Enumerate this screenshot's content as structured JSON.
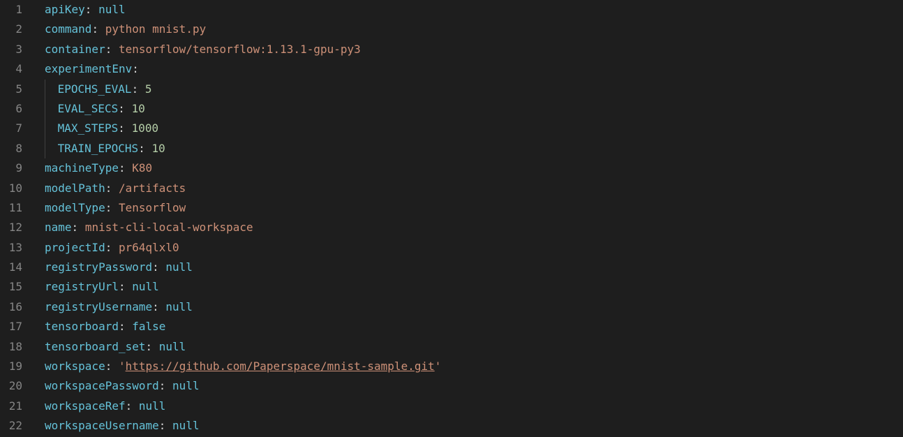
{
  "lines": [
    {
      "num": "1",
      "indent": 0,
      "guide": false,
      "key": "apiKey",
      "valueType": "null",
      "value": "null"
    },
    {
      "num": "2",
      "indent": 0,
      "guide": false,
      "key": "command",
      "valueType": "str",
      "value": "python mnist.py"
    },
    {
      "num": "3",
      "indent": 0,
      "guide": false,
      "key": "container",
      "valueType": "str",
      "value": "tensorflow/tensorflow:1.13.1-gpu-py3"
    },
    {
      "num": "4",
      "indent": 0,
      "guide": false,
      "key": "experimentEnv",
      "valueType": "none",
      "value": ""
    },
    {
      "num": "5",
      "indent": 1,
      "guide": true,
      "key": "EPOCHS_EVAL",
      "valueType": "num",
      "value": "5"
    },
    {
      "num": "6",
      "indent": 1,
      "guide": true,
      "key": "EVAL_SECS",
      "valueType": "num",
      "value": "10"
    },
    {
      "num": "7",
      "indent": 1,
      "guide": true,
      "key": "MAX_STEPS",
      "valueType": "num",
      "value": "1000"
    },
    {
      "num": "8",
      "indent": 1,
      "guide": true,
      "key": "TRAIN_EPOCHS",
      "valueType": "num",
      "value": "10"
    },
    {
      "num": "9",
      "indent": 0,
      "guide": false,
      "key": "machineType",
      "valueType": "str",
      "value": "K80"
    },
    {
      "num": "10",
      "indent": 0,
      "guide": false,
      "key": "modelPath",
      "valueType": "str",
      "value": "/artifacts"
    },
    {
      "num": "11",
      "indent": 0,
      "guide": false,
      "key": "modelType",
      "valueType": "str",
      "value": "Tensorflow"
    },
    {
      "num": "12",
      "indent": 0,
      "guide": false,
      "key": "name",
      "valueType": "str",
      "value": "mnist-cli-local-workspace"
    },
    {
      "num": "13",
      "indent": 0,
      "guide": false,
      "key": "projectId",
      "valueType": "str",
      "value": "pr64qlxl0"
    },
    {
      "num": "14",
      "indent": 0,
      "guide": false,
      "key": "registryPassword",
      "valueType": "null",
      "value": "null"
    },
    {
      "num": "15",
      "indent": 0,
      "guide": false,
      "key": "registryUrl",
      "valueType": "null",
      "value": "null"
    },
    {
      "num": "16",
      "indent": 0,
      "guide": false,
      "key": "registryUsername",
      "valueType": "null",
      "value": "null"
    },
    {
      "num": "17",
      "indent": 0,
      "guide": false,
      "key": "tensorboard",
      "valueType": "bool",
      "value": "false"
    },
    {
      "num": "18",
      "indent": 0,
      "guide": false,
      "key": "tensorboard_set",
      "valueType": "null",
      "value": "null"
    },
    {
      "num": "19",
      "indent": 0,
      "guide": false,
      "key": "workspace",
      "valueType": "quoted-link",
      "value": "https://github.com/Paperspace/mnist-sample.git"
    },
    {
      "num": "20",
      "indent": 0,
      "guide": false,
      "key": "workspacePassword",
      "valueType": "null",
      "value": "null"
    },
    {
      "num": "21",
      "indent": 0,
      "guide": false,
      "key": "workspaceRef",
      "valueType": "null",
      "value": "null"
    },
    {
      "num": "22",
      "indent": 0,
      "guide": false,
      "key": "workspaceUsername",
      "valueType": "null",
      "value": "null"
    }
  ]
}
